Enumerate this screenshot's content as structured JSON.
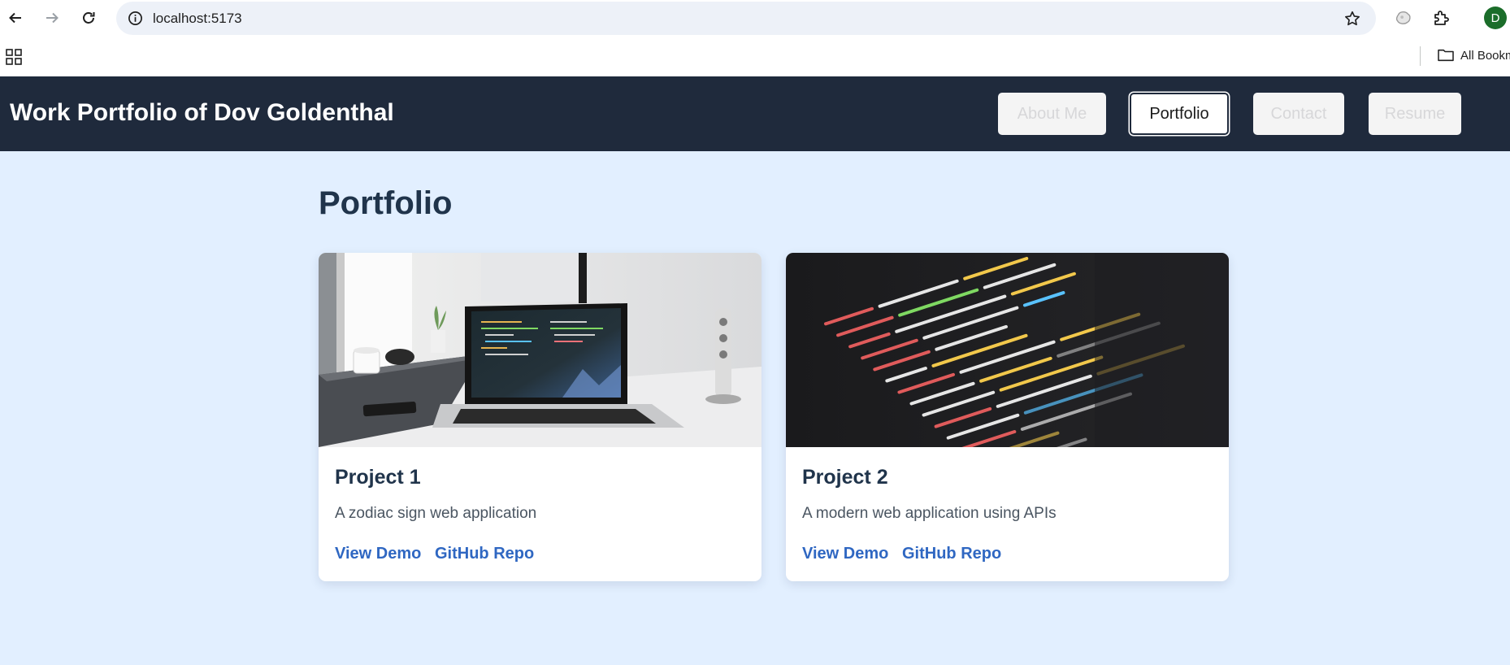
{
  "browser": {
    "url": "localhost:5173",
    "profile_initial": "D",
    "bookmarks_label": "All Bookmarks",
    "icons": [
      "back-icon",
      "forward-icon",
      "reload-icon",
      "info-icon",
      "star-icon",
      "extension-puzzle-icon",
      "apps-grid-icon",
      "folder-icon"
    ]
  },
  "site": {
    "title": "Work Portfolio of Dov Goldenthal",
    "nav": [
      {
        "label": "About Me",
        "active": false
      },
      {
        "label": "Portfolio",
        "active": true
      },
      {
        "label": "Contact",
        "active": false
      },
      {
        "label": "Resume",
        "active": false
      }
    ]
  },
  "main": {
    "heading": "Portfolio",
    "projects": [
      {
        "title": "Project 1",
        "description": "A zodiac sign web application",
        "demo_label": "View Demo",
        "repo_label": "GitHub Repo",
        "image": "laptop-on-desk-photo"
      },
      {
        "title": "Project 2",
        "description": "A modern web application using APIs",
        "demo_label": "View Demo",
        "repo_label": "GitHub Repo",
        "image": "code-on-screen-photo"
      }
    ]
  },
  "colors": {
    "header_bg": "#1f2a3c",
    "page_bg": "#e2efff",
    "link": "#2f67c2",
    "heading": "#20344b"
  }
}
